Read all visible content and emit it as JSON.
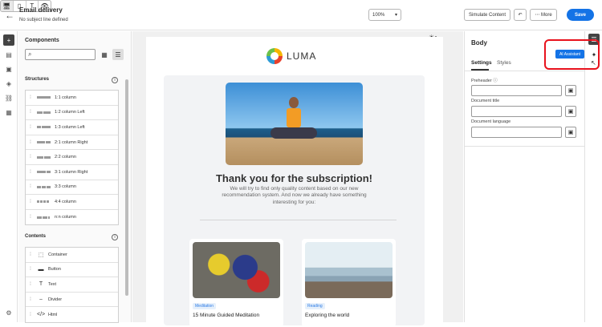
{
  "header": {
    "title": "Email delivery",
    "subtitle": "No subject line defined",
    "zoom": "100%",
    "simulate_label": "Simulate Content",
    "more_label": "More",
    "save_label": "Save"
  },
  "components": {
    "title": "Components",
    "structures_title": "Structures",
    "structures": [
      {
        "label": "1:1 column"
      },
      {
        "label": "1:2 column Left"
      },
      {
        "label": "1:3 column Left"
      },
      {
        "label": "2:1 column Right"
      },
      {
        "label": "2:2 column"
      },
      {
        "label": "3:1 column Right"
      },
      {
        "label": "3:3 column"
      },
      {
        "label": "4:4 column"
      },
      {
        "label": "n:n column"
      }
    ],
    "contents_title": "Contents",
    "contents": [
      {
        "label": "Container",
        "icon": "container-icon"
      },
      {
        "label": "Button",
        "icon": "button-icon"
      },
      {
        "label": "Text",
        "icon": "text-icon"
      },
      {
        "label": "Divider",
        "icon": "divider-icon"
      },
      {
        "label": "Html",
        "icon": "html-icon"
      }
    ]
  },
  "email": {
    "logo_text": "LUMA",
    "headline": "Thank you for the subscription!",
    "body": "We will try to find only quality content based on our new recommendation system. And now we already have something interesting for you:",
    "items": [
      {
        "tag": "Meditation",
        "title": "15 Minute Guided Meditation"
      },
      {
        "tag": "Reading",
        "title": "Exploring the world"
      }
    ]
  },
  "right_panel": {
    "title": "Body",
    "tabs": [
      "Settings",
      "Styles"
    ],
    "preheader_label": "Preheader",
    "document_title_label": "Document title",
    "document_language_label": "Document language",
    "ai_assistant_label": "AI Assistant"
  },
  "colors": {
    "accent": "#1473e6",
    "highlight": "#e8121d"
  }
}
